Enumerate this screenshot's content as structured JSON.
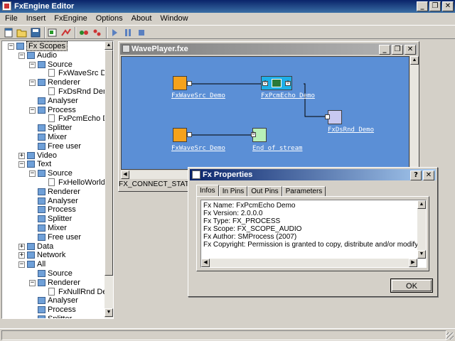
{
  "app": {
    "title": "FxEngine Editor",
    "window_buttons": {
      "minimize": "_",
      "restore": "❐",
      "close": "✕"
    }
  },
  "menu": [
    "File",
    "Insert",
    "FxEngine",
    "Options",
    "About",
    "Window"
  ],
  "toolbar": {
    "icons": [
      "new-icon",
      "open-icon",
      "save-icon",
      "add-fx-icon",
      "remove-fx-icon",
      "connect-icon",
      "disconnect-icon",
      "play-icon",
      "pause-icon",
      "stop-icon"
    ]
  },
  "tree": {
    "nodes": [
      {
        "label": "Fx Scopes",
        "level": 0,
        "expander": "minus",
        "icon": "folder",
        "selected": true
      },
      {
        "label": "Audio",
        "level": 1,
        "expander": "minus",
        "icon": "folder"
      },
      {
        "label": "Source",
        "level": 2,
        "expander": "minus",
        "icon": "folder"
      },
      {
        "label": "FxWaveSrc Demo",
        "level": 3,
        "expander": "none",
        "icon": "doc"
      },
      {
        "label": "Renderer",
        "level": 2,
        "expander": "minus",
        "icon": "folder"
      },
      {
        "label": "FxDsRnd Demo",
        "level": 3,
        "expander": "none",
        "icon": "doc"
      },
      {
        "label": "Analyser",
        "level": 2,
        "expander": "none",
        "icon": "folder"
      },
      {
        "label": "Process",
        "level": 2,
        "expander": "minus",
        "icon": "folder"
      },
      {
        "label": "FxPcmEcho Demo",
        "level": 3,
        "expander": "none",
        "icon": "doc"
      },
      {
        "label": "Splitter",
        "level": 2,
        "expander": "none",
        "icon": "folder"
      },
      {
        "label": "Mixer",
        "level": 2,
        "expander": "none",
        "icon": "folder"
      },
      {
        "label": "Free user",
        "level": 2,
        "expander": "none",
        "icon": "folder"
      },
      {
        "label": "Video",
        "level": 1,
        "expander": "plus",
        "icon": "folder"
      },
      {
        "label": "Text",
        "level": 1,
        "expander": "minus",
        "icon": "folder"
      },
      {
        "label": "Source",
        "level": 2,
        "expander": "minus",
        "icon": "folder"
      },
      {
        "label": "FxHelloWorldSrc",
        "level": 3,
        "expander": "none",
        "icon": "doc"
      },
      {
        "label": "Renderer",
        "level": 2,
        "expander": "none",
        "icon": "folder"
      },
      {
        "label": "Analyser",
        "level": 2,
        "expander": "none",
        "icon": "folder"
      },
      {
        "label": "Process",
        "level": 2,
        "expander": "none",
        "icon": "folder"
      },
      {
        "label": "Splitter",
        "level": 2,
        "expander": "none",
        "icon": "folder"
      },
      {
        "label": "Mixer",
        "level": 2,
        "expander": "none",
        "icon": "folder"
      },
      {
        "label": "Free user",
        "level": 2,
        "expander": "none",
        "icon": "folder"
      },
      {
        "label": "Data",
        "level": 1,
        "expander": "plus",
        "icon": "folder"
      },
      {
        "label": "Network",
        "level": 1,
        "expander": "plus",
        "icon": "folder"
      },
      {
        "label": "All",
        "level": 1,
        "expander": "minus",
        "icon": "folder"
      },
      {
        "label": "Source",
        "level": 2,
        "expander": "none",
        "icon": "folder"
      },
      {
        "label": "Renderer",
        "level": 2,
        "expander": "minus",
        "icon": "folder"
      },
      {
        "label": "FxNullRnd Demo",
        "level": 3,
        "expander": "none",
        "icon": "doc"
      },
      {
        "label": "Analyser",
        "level": 2,
        "expander": "none",
        "icon": "folder"
      },
      {
        "label": "Process",
        "level": 2,
        "expander": "none",
        "icon": "folder"
      },
      {
        "label": "Splitter",
        "level": 2,
        "expander": "none",
        "icon": "folder"
      }
    ]
  },
  "child_window": {
    "title": "WavePlayer.fxe",
    "status": "FX_CONNECT_STATE",
    "canvas_color": "#5b8fd6",
    "nodes": [
      {
        "id": "wavesrc1",
        "label": "FxWaveSrc Demo",
        "color": "#f5a21c"
      },
      {
        "id": "pcmecho",
        "label": "FxPcmEcho Demo",
        "color": "#1fb0e8",
        "pin_in_label": "0",
        "pin_out_label": "0"
      },
      {
        "id": "dsrnd",
        "label": "FxDsRnd Demo",
        "color": "#c8c8f0"
      },
      {
        "id": "wavesrc2",
        "label": "FxWaveSrc Demo",
        "color": "#f5a21c"
      },
      {
        "id": "endstream",
        "label": "End of stream",
        "color": "#b8f0b8",
        "pin_in_label": "0"
      }
    ]
  },
  "dialog": {
    "title": "Fx Properties",
    "buttons": {
      "help": "?",
      "close": "✕"
    },
    "tabs": [
      {
        "label": "Infos",
        "active": true
      },
      {
        "label": "In Pins",
        "active": false
      },
      {
        "label": "Out Pins",
        "active": false
      },
      {
        "label": "Parameters",
        "active": false
      }
    ],
    "info_lines": [
      "Fx Name: FxPcmEcho Demo",
      "Fx Version: 2.0.0.0",
      "Fx Type: FX_PROCESS",
      "Fx Scope: FX_SCOPE_AUDIO",
      "Fx Author: SMProcess (2007)",
      "Fx Copyright: Permission is granted to copy, distribute and/or modify this Fx."
    ],
    "ok_label": "OK"
  }
}
